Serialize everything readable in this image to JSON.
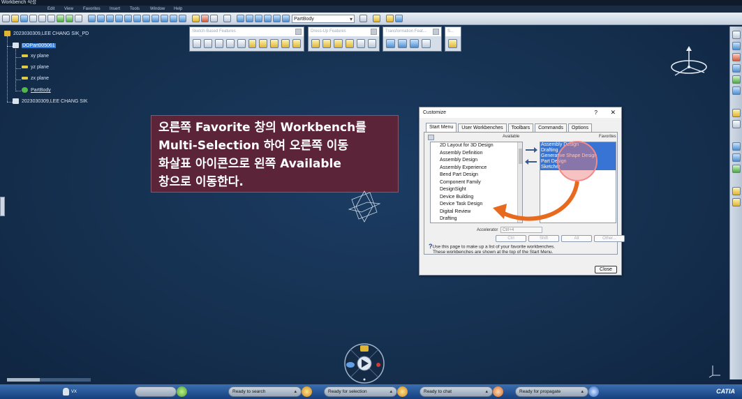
{
  "window": {
    "title": "Workbench 작성"
  },
  "menubar": {
    "items": [
      "Edit",
      "View",
      "Favorites",
      "Insert",
      "Tools",
      "Window",
      "Help"
    ]
  },
  "toolbar": {
    "dropdown_value": "PartBody"
  },
  "floating_toolbars": [
    {
      "title": "Sketch-Based Features"
    },
    {
      "title": "Dress-Up Features"
    },
    {
      "title": "Transformation Feat..."
    },
    {
      "title": "S..."
    }
  ],
  "tree": {
    "root": "2023030309,LEE CHANG SIK_PD",
    "part": "DOPart005061",
    "planes": [
      "xy plane",
      "yz plane",
      "zx plane"
    ],
    "body": "PartBody",
    "root2": "2023030309,LEE CHANG SIK"
  },
  "callout": {
    "lines": [
      "오른쪽 Favorite 창의 Workbench를",
      "Multi-Selection 하여 오른쪽 이동",
      "화살표 아이콘으로 왼쪽 Available",
      "창으로 이동한다."
    ]
  },
  "dialog": {
    "title": "Customize",
    "help_glyph": "?",
    "close_glyph": "✕",
    "tabs": [
      "Start Menu",
      "User Workbenches",
      "Toolbars",
      "Commands",
      "Options"
    ],
    "available_label": "Available",
    "favorites_label": "Favorites",
    "available_items": [
      "2D Layout for 3D Design",
      "Assembly Definition",
      "Assembly Design",
      "Assembly Experience",
      "Bend Part Design",
      "Component Family",
      "DesignSight",
      "Device Building",
      "Device Task Design",
      "Digital Review",
      "Drafting"
    ],
    "favorite_items": [
      "Assembly Design",
      "Drafting",
      "Generative Shape Design",
      "Part Design",
      "Sketcher"
    ],
    "accelerator_label": "Accelerator",
    "accelerator_value": "Ctrl+4",
    "modifier_buttons": [
      "Ctrl",
      "Shift",
      "Alt",
      "Other..."
    ],
    "help_line1": "Use this page to make up a list of your favorite workbenches.",
    "help_line2": "These workbenches are shown at the top of the Start Menu.",
    "close_label": "Close"
  },
  "taskbar": {
    "user": "VX",
    "items": [
      "Ready to search",
      "Ready for selection",
      "Ready to chat",
      "Ready for propagate"
    ],
    "brand": "CATIA"
  },
  "colors": {
    "background": "#15304f",
    "callout": "#5b2438",
    "selection": "#3874d4",
    "orange_arrow": "#e86a1e"
  }
}
